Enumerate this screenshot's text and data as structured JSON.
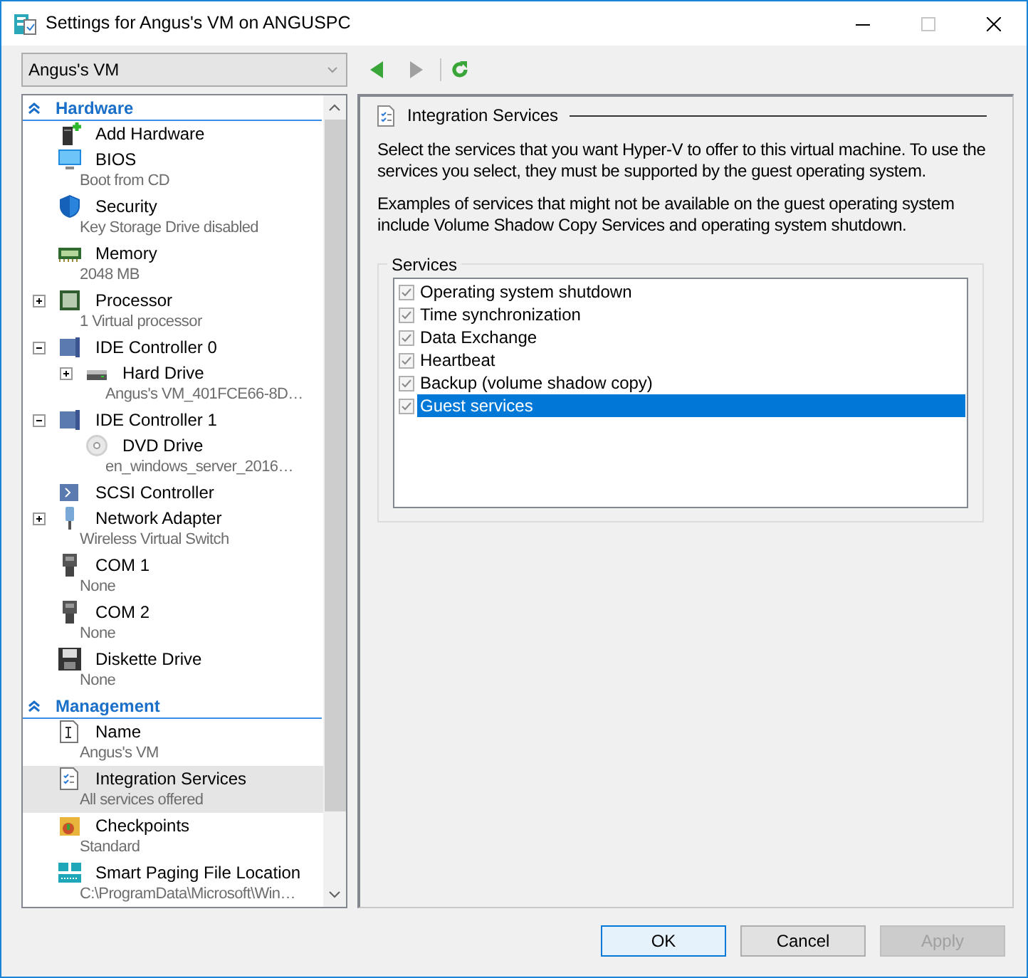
{
  "window": {
    "title": "Settings for Angus's VM on ANGUSPC",
    "maximize_disabled": true
  },
  "vm_selector": {
    "value": "Angus's VM"
  },
  "toolbar": {
    "back_disabled": false,
    "forward_disabled": true
  },
  "sidebar": {
    "sections": [
      {
        "title": "Hardware",
        "expanded": true,
        "items": [
          {
            "label": "Add Hardware",
            "selected": false
          },
          {
            "label": "BIOS",
            "detail": "Boot from CD",
            "selected": false
          },
          {
            "label": "Security",
            "detail": "Key Storage Drive disabled",
            "selected": false
          },
          {
            "label": "Memory",
            "detail": "2048 MB",
            "selected": false
          },
          {
            "label": "Processor",
            "detail": "1 Virtual processor",
            "expanded": false,
            "selected": false
          },
          {
            "label": "IDE Controller 0",
            "expanded": true,
            "selected": false,
            "children": [
              {
                "label": "Hard Drive",
                "detail": "Angus's VM_401FCE66-8D…",
                "expanded": false,
                "selected": false
              }
            ]
          },
          {
            "label": "IDE Controller 1",
            "expanded": true,
            "selected": false,
            "children": [
              {
                "label": "DVD Drive",
                "detail": "en_windows_server_2016…",
                "selected": false
              }
            ]
          },
          {
            "label": "SCSI Controller",
            "selected": false
          },
          {
            "label": "Network Adapter",
            "detail": "Wireless Virtual Switch",
            "expanded": false,
            "selected": false
          },
          {
            "label": "COM 1",
            "detail": "None",
            "selected": false
          },
          {
            "label": "COM 2",
            "detail": "None",
            "selected": false
          },
          {
            "label": "Diskette Drive",
            "detail": "None",
            "selected": false
          }
        ]
      },
      {
        "title": "Management",
        "expanded": true,
        "items": [
          {
            "label": "Name",
            "detail": "Angus's VM",
            "selected": false
          },
          {
            "label": "Integration Services",
            "detail": "All services offered",
            "selected": true
          },
          {
            "label": "Checkpoints",
            "detail": "Standard",
            "selected": false
          },
          {
            "label": "Smart Paging File Location",
            "detail": "C:\\ProgramData\\Microsoft\\Win…",
            "selected": false
          }
        ]
      }
    ]
  },
  "panel": {
    "heading": "Integration Services",
    "paragraphs": [
      "Select the services that you want Hyper-V to offer to this virtual machine. To use the services you select, they must be supported by the guest operating system.",
      "Examples of services that might not be available on the guest operating system include Volume Shadow Copy Services and operating system shutdown."
    ],
    "services_group": {
      "title": "Services",
      "items": [
        {
          "label": "Operating system shutdown",
          "checked": true,
          "selected": false
        },
        {
          "label": "Time synchronization",
          "checked": true,
          "selected": false
        },
        {
          "label": "Data Exchange",
          "checked": true,
          "selected": false
        },
        {
          "label": "Heartbeat",
          "checked": true,
          "selected": false
        },
        {
          "label": "Backup (volume shadow copy)",
          "checked": true,
          "selected": false
        },
        {
          "label": "Guest services",
          "checked": true,
          "selected": true
        }
      ]
    }
  },
  "buttons": [
    {
      "label": "OK",
      "kind": "default",
      "disabled": false
    },
    {
      "label": "Cancel",
      "kind": "normal",
      "disabled": false
    },
    {
      "label": "Apply",
      "kind": "normal",
      "disabled": true
    }
  ]
}
